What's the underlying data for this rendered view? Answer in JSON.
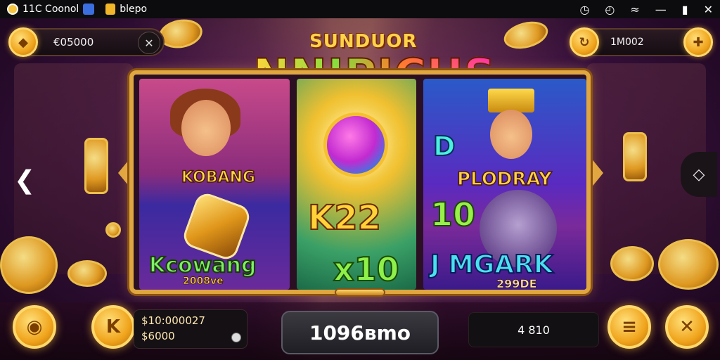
{
  "status_bar": {
    "app_label": "11C Coonol",
    "app2_label": "blepo"
  },
  "balance_left": {
    "amount": "€05000"
  },
  "balance_right": {
    "amount": "1M002"
  },
  "title": {
    "small": "SUNDUOR",
    "big": "NNIPICHS"
  },
  "reels": {
    "reel1": {
      "label_top": "KOBANG",
      "label_mid": "Kcowang",
      "label_code": "2008ve"
    },
    "reel2": {
      "label_top": "K22",
      "label_bottom": "x10"
    },
    "reel3": {
      "label_letter": "D",
      "label_top": "PLODRAY",
      "label_mid": "10",
      "label_bottom": "J MGARK",
      "label_code": "299DE"
    }
  },
  "bottom": {
    "win_line1": "$10:000027",
    "win_line2": "$6000",
    "spin_text": "1096вmo",
    "bet_text": "4 810"
  },
  "icons": {
    "status": [
      "clock-icon",
      "alarm-icon",
      "wifi-icon",
      "minimize-icon",
      "battery-icon",
      "close-icon"
    ]
  }
}
